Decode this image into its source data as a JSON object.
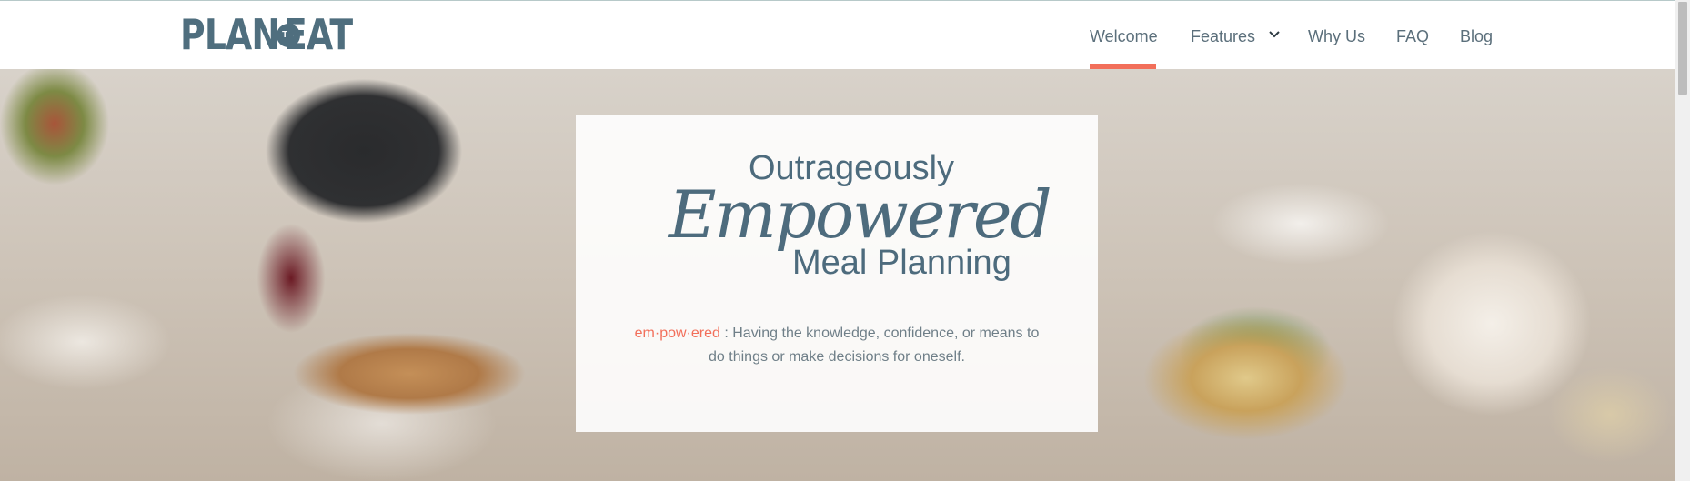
{
  "brand": {
    "logo_part1": "PLAN",
    "logo_part2": "TO",
    "logo_part3": "EAT",
    "color": "#4f6e7e"
  },
  "nav": {
    "items": [
      {
        "label": "Welcome",
        "active": true
      },
      {
        "label": "Features",
        "has_dropdown": true
      },
      {
        "label": "Why Us"
      },
      {
        "label": "FAQ"
      },
      {
        "label": "Blog"
      }
    ],
    "active_color": "#f26f5a"
  },
  "hero": {
    "headline_top": "Outrageously",
    "headline_script": "Empowered",
    "headline_bottom": "Meal Planning",
    "definition_word": "em·pow·ered",
    "definition_text": " : Having the knowledge, confidence, or means to do things or make decisions for oneself."
  },
  "icons": {
    "dropdown": "chevron-down-icon"
  }
}
